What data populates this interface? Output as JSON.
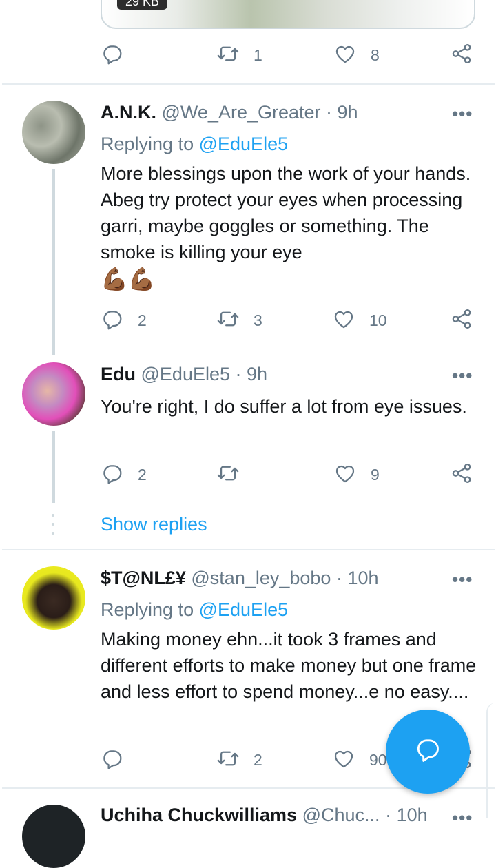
{
  "top_tweet": {
    "media_size": "29 KB",
    "retweets": "1",
    "likes": "8"
  },
  "reply1": {
    "name": "A.N.K.",
    "handle": "@We_Are_Greater",
    "time": "· 9h",
    "replying_prefix": "Replying to",
    "replying_to": "@EduEle5",
    "text": "More blessings upon the work of your hands. Abeg try protect your eyes when processing garri, maybe goggles or something. The smoke is killing your eye",
    "emoji": "💪🏾💪🏾",
    "replies": "2",
    "retweets": "3",
    "likes": "10"
  },
  "reply2": {
    "name": "Edu",
    "handle": "@EduEle5",
    "time": "· 9h",
    "text": "You're right, I do suffer a lot from eye issues.",
    "replies": "2",
    "likes": "9"
  },
  "show_replies": "Show replies",
  "reply3": {
    "name": "$T@NL£¥",
    "handle": "@stan_ley_bobo",
    "time": "· 10h",
    "replying_prefix": "Replying to",
    "replying_to": "@EduEle5",
    "text": "Making money ehn...it took 3 frames and different efforts to make money but one frame and less effort to spend money...e no easy....",
    "retweets": "2",
    "likes": "90"
  },
  "reply4": {
    "name": "Uchiha Chuckwilliams",
    "handle": "@Chuc...",
    "time": "· 10h"
  },
  "colors": {
    "accent": "#1da1f2",
    "secondary_text": "#657786",
    "icon": "#657786"
  },
  "icons": [
    "reply-icon",
    "retweet-icon",
    "like-icon",
    "share-icon",
    "more-icon",
    "compose-reply-icon"
  ]
}
